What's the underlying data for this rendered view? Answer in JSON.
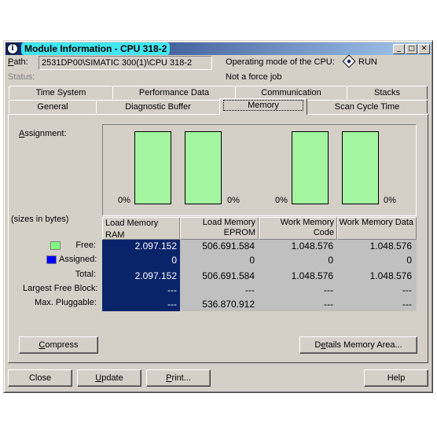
{
  "window": {
    "title": "Module Information - CPU 318-2",
    "minimize": "_",
    "maximize": "□",
    "close": "✕"
  },
  "info": {
    "path_label": "Path:",
    "path_value": "2531DP00\\SIMATIC 300(1)\\CPU 318-2",
    "status_label": "Status:",
    "opmode_label": "Operating mode of the  CPU:",
    "opmode_value": "RUN",
    "force_text": "Not a force job"
  },
  "tabs_back": [
    "Time System",
    "Performance Data",
    "Communication",
    "Stacks"
  ],
  "tabs_front": [
    "General",
    "Diagnostic Buffer",
    "Memory",
    "Scan Cycle Time"
  ],
  "active_tab": "Memory",
  "memory": {
    "assignment_label": "Assignment:",
    "sizes_label": "(sizes in bytes)",
    "bar_labels": [
      "0%",
      "0%",
      "0%",
      "0%"
    ],
    "bar_fill_fraction": [
      1.0,
      1.0,
      1.0,
      1.0
    ],
    "columns": [
      "Load Memory RAM",
      "Load Memory EPROM",
      "Work Memory Code",
      "Work Memory Data"
    ],
    "rows": [
      {
        "label": "Free:",
        "values": [
          "2.097.152",
          "506.691.584",
          "1.048.576",
          "1.048.576"
        ]
      },
      {
        "label": "Assigned:",
        "values": [
          "0",
          "0",
          "0",
          "0"
        ]
      },
      {
        "label": "Total:",
        "values": [
          "2.097.152",
          "506.691.584",
          "1.048.576",
          "1.048.576"
        ]
      },
      {
        "label": "Largest Free Block:",
        "values": [
          "---",
          "---",
          "---",
          "---"
        ]
      },
      {
        "label": "Max. Pluggable:",
        "values": [
          "---",
          "536.870.912",
          "---",
          "---"
        ]
      }
    ],
    "free_color": "#80ff80",
    "assigned_color": "#0000ff",
    "selected_color": "#0a246a"
  },
  "buttons": {
    "compress": "Compress",
    "details": "Details Memory Area...",
    "close": "Close",
    "update": "Update",
    "print": "Print...",
    "help": "Help"
  }
}
